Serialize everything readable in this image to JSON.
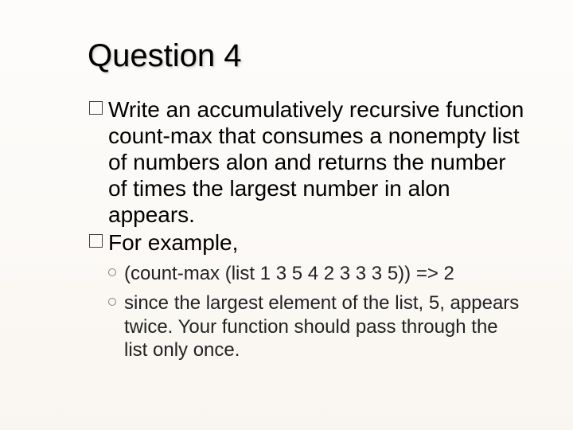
{
  "title": "Question 4",
  "bullets": [
    {
      "text": "Write an accumulatively recursive function count-max that consumes a nonempty list of numbers alon and returns the number of times the largest number in alon appears."
    },
    {
      "text": "For example,"
    }
  ],
  "subbullets": [
    {
      "text": "(count-max (list 1 3 5 4 2 3 3 3 5)) => 2"
    },
    {
      "text": "since the largest element of the list, 5, appears twice. Your function should pass through the list only once."
    }
  ]
}
